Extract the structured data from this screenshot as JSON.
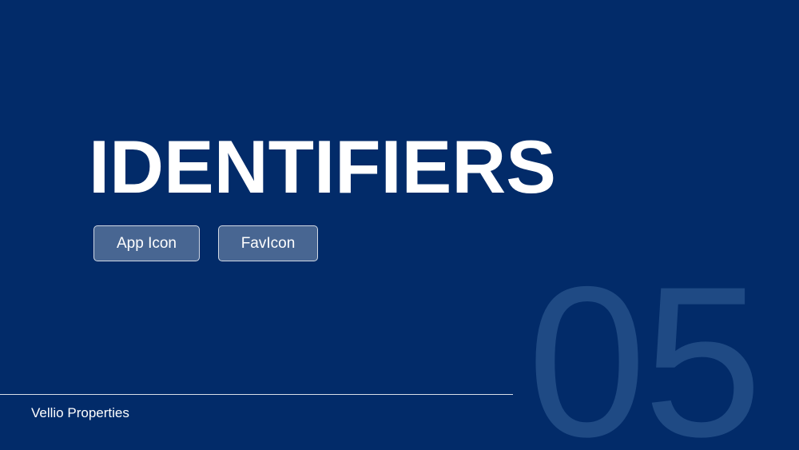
{
  "slide": {
    "title": "IDENTIFIERS",
    "section_number": "05",
    "tags": [
      {
        "label": "App Icon"
      },
      {
        "label": "FavIcon"
      }
    ],
    "footer_brand": "Vellio Properties"
  },
  "colors": {
    "background": "#022b69",
    "text": "#ffffff",
    "section_number": "#1f4a84",
    "tag_fill": "rgba(255,255,255,0.28)"
  }
}
